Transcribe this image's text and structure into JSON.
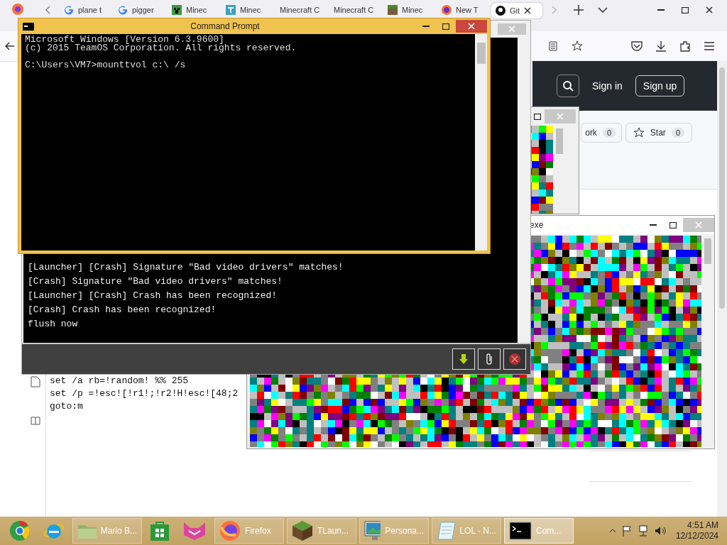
{
  "browser": {
    "tabs": [
      {
        "label": "plane t",
        "selected": false
      },
      {
        "label": "pigger",
        "selected": false
      },
      {
        "label": "Minec",
        "selected": false
      },
      {
        "label": "Minec",
        "selected": false
      },
      {
        "label": "Minecraft C",
        "selected": false
      },
      {
        "label": "Minecraft C",
        "selected": false
      },
      {
        "label": "Minec",
        "selected": false
      },
      {
        "label": "New T",
        "selected": false
      },
      {
        "label": "Git",
        "selected": true
      }
    ],
    "github": {
      "sign_in": "Sign in",
      "sign_up": "Sign up",
      "fork_label": "ork",
      "fork_count": "0",
      "star_label": "Star",
      "star_count": "0"
    },
    "code_lines": [
      "set /a rb=!random! %% 255",
      "set /p =!esc![!r1!;!r2!H!esc![48;2",
      "goto:m"
    ]
  },
  "launcher": {
    "log_lines": [
      "[Launcher] [Crash] Signature \"Bad video drivers\" matches!",
      "[Crash] Signature \"Bad video drivers\" matches!",
      "[Launcher] [Crash] Crash has been recognized!",
      "[Crash] Crash has been recognized!",
      "flush now"
    ]
  },
  "noise_window": {
    "title": "exe"
  },
  "cmd": {
    "title": "Command Prompt",
    "header_lines": [
      "Microsoft Windows [Version 6.3.9600]",
      "(c) 2015 TeamOS Corporation. All rights reserved."
    ],
    "prompt": "C:\\Users\\VM7>mounttvol c:\\ /s"
  },
  "taskbar": {
    "items": [
      {
        "kind": "chrome",
        "selected": false
      },
      {
        "kind": "ie",
        "selected": false
      },
      {
        "kind": "folder",
        "label": "Mario B...",
        "selected": false
      },
      {
        "kind": "store",
        "selected": false
      },
      {
        "kind": "cat",
        "selected": false
      },
      {
        "kind": "firefox",
        "label": "Firefox",
        "selected": false
      },
      {
        "kind": "block",
        "label": "TLaun...",
        "selected": false
      },
      {
        "kind": "monitor",
        "label": "Persona...",
        "selected": false
      },
      {
        "kind": "notepad",
        "label": "LOL - N...",
        "selected": false
      },
      {
        "kind": "cmd",
        "label": "Com...",
        "selected": true
      }
    ],
    "time": "4:51 AM",
    "date": "12/12/2024"
  }
}
